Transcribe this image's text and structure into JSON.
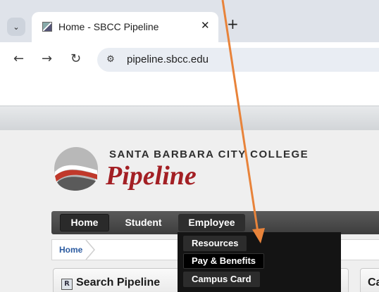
{
  "browser": {
    "tab": {
      "title": "Home - SBCC Pipeline",
      "close_glyph": "✕"
    },
    "new_tab_glyph": "+",
    "tab_search_glyph": "⌄",
    "nav": {
      "back": "←",
      "forward": "→",
      "reload": "↻"
    },
    "site_info_glyph": "⚙",
    "url": "pipeline.sbcc.edu"
  },
  "header": {
    "college_name": "SANTA BARBARA CITY COLLEGE",
    "app_name": "Pipeline",
    "brand_color": "#a31f24"
  },
  "navbar": {
    "items": [
      {
        "label": "Home"
      },
      {
        "label": "Student"
      },
      {
        "label": "Employee"
      }
    ]
  },
  "breadcrumb": {
    "home": "Home"
  },
  "dropdown": {
    "items": [
      {
        "label": "Resources"
      },
      {
        "label": "Pay & Benefits"
      },
      {
        "label": "Campus Card"
      }
    ]
  },
  "panels": {
    "search": {
      "icon_letter": "R",
      "title": "Search Pipeline"
    },
    "right": {
      "title": "Ca"
    }
  },
  "annotation": {
    "arrow_color": "#e8833a"
  }
}
